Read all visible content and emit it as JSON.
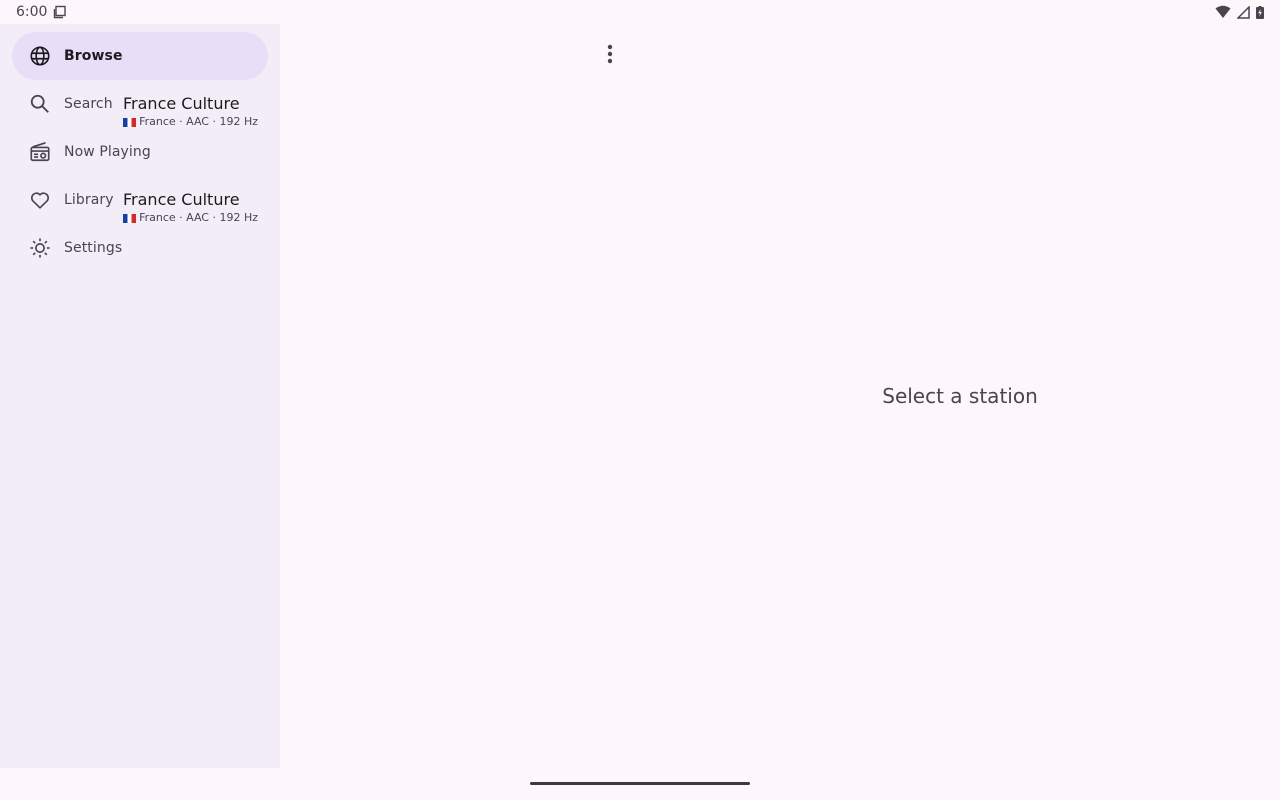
{
  "status_bar": {
    "time": "6:00"
  },
  "nav": {
    "items": [
      {
        "label": "Browse",
        "icon": "globe-icon",
        "active": true
      },
      {
        "label": "Search",
        "icon": "search-icon",
        "active": false
      },
      {
        "label": "Now Playing",
        "icon": "radio-icon",
        "active": false
      },
      {
        "label": "Library",
        "icon": "heart-icon",
        "active": false
      },
      {
        "label": "Settings",
        "icon": "brightness-icon",
        "active": false
      }
    ]
  },
  "peek_items": [
    {
      "title": "France Culture",
      "subtitle": "France · AAC · 192 Hz"
    },
    {
      "title": "France Culture",
      "subtitle": "France · AAC · 192 Hz"
    }
  ],
  "main": {
    "empty_message": "Select a station"
  },
  "colors": {
    "background": "#fdf7fc",
    "rail": "#f3edf7",
    "active_indicator": "#e8def8"
  }
}
